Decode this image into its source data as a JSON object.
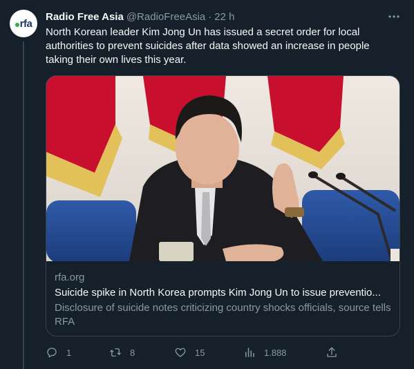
{
  "account": {
    "name": "Radio Free Asia",
    "handle": "@RadioFreeAsia",
    "separator": "·",
    "time": "22 h",
    "avatar_text": "rfa"
  },
  "tweet": {
    "text": "North Korean leader Kim Jong Un has issued a secret order for local authorities to prevent suicides after data showed an increase in people taking their own lives this year."
  },
  "card": {
    "domain": "rfa.org",
    "title": "Suicide spike in North Korea prompts Kim Jong Un to issue preventio...",
    "description": "Disclosure of suicide notes criticizing country shocks officials, source tells RFA"
  },
  "actions": {
    "replies": "1",
    "retweets": "8",
    "likes": "15",
    "views": "1.888"
  },
  "icons": {
    "more": "more-icon",
    "reply": "reply-icon",
    "retweet": "retweet-icon",
    "like": "heart-icon",
    "views": "views-icon",
    "share": "share-icon"
  },
  "colors": {
    "background": "#15202b",
    "text_primary": "#f7f9f9",
    "text_secondary": "#8b98a5",
    "border": "#38444d",
    "brand_navy": "#17365d",
    "brand_green": "#3aa845"
  }
}
